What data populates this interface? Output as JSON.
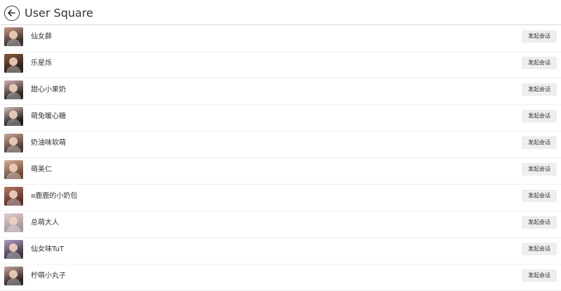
{
  "header": {
    "title": "User Square",
    "back_icon": "arrow-left-icon"
  },
  "users": [
    {
      "name": "仙女薛",
      "button": "发起会话",
      "avatar_colors": [
        "#3a2f2f",
        "#c99a86"
      ]
    },
    {
      "name": "乐星烁",
      "button": "发起会话",
      "avatar_colors": [
        "#2b1f1a",
        "#8a5a3e"
      ]
    },
    {
      "name": "甜心小果奶",
      "button": "发起会话",
      "avatar_colors": [
        "#2a2424",
        "#cfb4b2"
      ]
    },
    {
      "name": "萌兔暖心糖",
      "button": "发起会话",
      "avatar_colors": [
        "#1e1a1c",
        "#d9bfb7"
      ]
    },
    {
      "name": "奶油味软萌",
      "button": "发起会话",
      "avatar_colors": [
        "#4b3a36",
        "#caa896"
      ]
    },
    {
      "name": "萌美仁",
      "button": "发起会话",
      "avatar_colors": [
        "#6e4a38",
        "#d6b093"
      ]
    },
    {
      "name": "¤鹿鹿的小奶包",
      "button": "发起会话",
      "avatar_colors": [
        "#5b2e2a",
        "#b87a66"
      ]
    },
    {
      "name": "总萌大人",
      "button": "发起会话",
      "avatar_colors": [
        "#a7969c",
        "#e1cfd2"
      ]
    },
    {
      "name": "仙女味TuT",
      "button": "发起会话",
      "avatar_colors": [
        "#3d3447",
        "#b09cc0"
      ]
    },
    {
      "name": "柠萌小丸子",
      "button": "发起会话",
      "avatar_colors": [
        "#2c2222",
        "#c7a6a0"
      ]
    }
  ]
}
